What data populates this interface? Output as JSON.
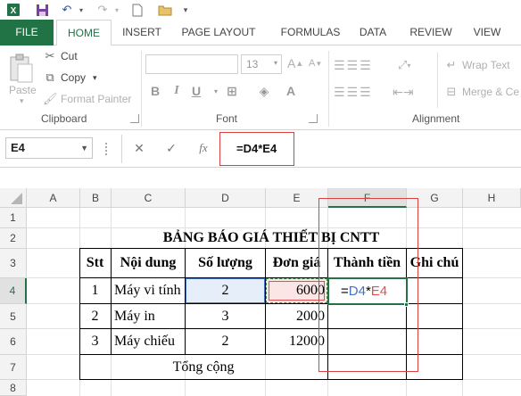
{
  "quick_access": {
    "icons": [
      "excel-logo-icon",
      "save-icon",
      "undo-icon",
      "redo-icon",
      "new-doc-icon",
      "open-folder-icon",
      "customize-icon"
    ]
  },
  "tabs": [
    "FILE",
    "HOME",
    "INSERT",
    "PAGE LAYOUT",
    "FORMULAS",
    "DATA",
    "REVIEW",
    "VIEW"
  ],
  "ribbon": {
    "clipboard": {
      "paste": "Paste",
      "cut": "Cut",
      "copy": "Copy",
      "format_painter": "Format Painter",
      "group_label": "Clipboard"
    },
    "font": {
      "font_size": "13",
      "group_label": "Font"
    },
    "alignment": {
      "wrap_text": "Wrap Text",
      "merge": "Merge & Ce",
      "group_label": "Alignment"
    }
  },
  "formula_bar": {
    "name_box": "E4",
    "cancel": "✕",
    "enter": "✓",
    "fx": "fx",
    "formula": "=D4*E4"
  },
  "columns": [
    "A",
    "B",
    "C",
    "D",
    "E",
    "F",
    "G",
    "H"
  ],
  "rows": [
    "1",
    "2",
    "3",
    "4",
    "5",
    "6",
    "7",
    "8"
  ],
  "sheet": {
    "title": "BẢNG BÁO GIÁ THIẾT BỊ CNTT",
    "headers": [
      "Stt",
      "Nội dung",
      "Số lượng",
      "Đơn giá",
      "Thành tiền",
      "Ghi chú"
    ],
    "items": [
      {
        "stt": "1",
        "name": "Máy vi tính",
        "qty": "2",
        "price": "6000"
      },
      {
        "stt": "2",
        "name": "Máy in",
        "qty": "3",
        "price": "2000"
      },
      {
        "stt": "3",
        "name": "Máy chiếu",
        "qty": "2",
        "price": "12000"
      }
    ],
    "total_label": "Tổng cộng",
    "editing_formula": {
      "eq": "=",
      "ref1": "D4",
      "op": "*",
      "ref2": "E4"
    }
  },
  "colors": {
    "excel_green": "#217346",
    "ref_blue": "#4472c4",
    "ref_red": "#e05050",
    "highlight_red": "#d94040"
  }
}
